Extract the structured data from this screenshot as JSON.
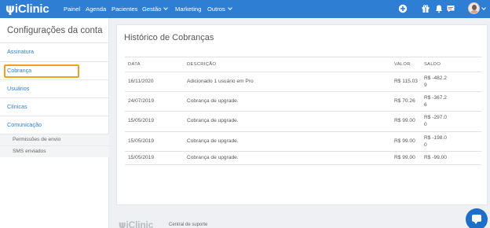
{
  "navbar": {
    "logo_mark": "ψ",
    "logo_text": "iClinic",
    "items": [
      {
        "label": "Painel"
      },
      {
        "label": "Agenda"
      },
      {
        "label": "Pacientes"
      },
      {
        "label": "Gestão"
      },
      {
        "label": "Marketing"
      },
      {
        "label": "Outros"
      }
    ],
    "icons": [
      "add-circle-icon",
      "gift-icon",
      "bell-icon",
      "chat-icon",
      "avatar",
      "chevron-down-icon"
    ],
    "accent_color": "#2e7fd3"
  },
  "sidebar": {
    "title": "Configurações da conta",
    "items": [
      {
        "label": "Assinatura"
      },
      {
        "label": "Cobrança"
      },
      {
        "label": "Usuários"
      },
      {
        "label": "Clínicas"
      },
      {
        "label": "Comunicação"
      }
    ],
    "subitems": [
      {
        "label": "Permissões de envio"
      },
      {
        "label": "SMS enviados"
      }
    ],
    "active_highlight_color": "#f0a020"
  },
  "main": {
    "title": "Histórico de Cobranças",
    "table": {
      "headers": {
        "data": "DATA",
        "descricao": "DESCRIÇÃO",
        "valor": "VALOR",
        "saldo": "SALDO"
      },
      "rows": [
        {
          "data": "16/11/2020",
          "descricao": "Adicionado 1 usuário em Pro",
          "valor": "R$ 115.03",
          "saldo": "R$ -482.29"
        },
        {
          "data": "24/07/2019",
          "descricao": "Cobrança de upgrade.",
          "valor": "R$ 70.26",
          "saldo": "R$ -367.26"
        },
        {
          "data": "15/05/2019",
          "descricao": "Cobrança de upgrade.",
          "valor": "R$ 99.00",
          "saldo": "R$ -297.00"
        },
        {
          "data": "15/05/2019",
          "descricao": "Cobrança de upgrade.",
          "valor": "R$ 99.00",
          "saldo": "R$ -198.00"
        },
        {
          "data": "15/05/2019",
          "descricao": "Cobrança de upgrade.",
          "valor": "R$ 99.00",
          "saldo": "R$ -99.00"
        }
      ]
    }
  },
  "footer": {
    "logo_mark": "ψ",
    "logo_text": "iClinic",
    "support_link": "Central de suporte"
  },
  "chat": {
    "icon": "chat-bubble-icon",
    "color": "#1d6fc7"
  }
}
